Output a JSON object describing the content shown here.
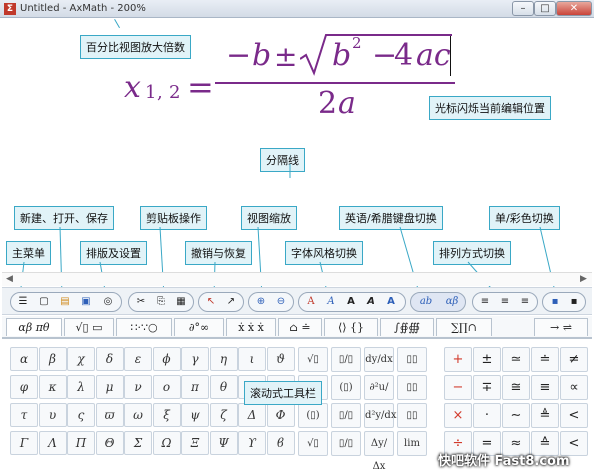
{
  "window": {
    "title": "Untitled - AxMath - 200%",
    "controls": [
      "–",
      "□",
      "✕"
    ]
  },
  "equation": {
    "x": "x",
    "sub1": "1",
    "comma": ",",
    "sub2": "2",
    "eq": "=",
    "minus": "−",
    "b": "b",
    "pm": "±",
    "b2": "b",
    "exp": "2",
    "minus2": "−",
    "four": "4",
    "ac": "ac",
    "denom_two": "2",
    "denom_a": "a"
  },
  "callouts": {
    "zoom": "百分比视图放大倍数",
    "cursor": "光标闪烁当前编辑位置",
    "divider": "分隔线",
    "new_open_save": "新建、打开、保存",
    "clipboard": "剪贴板操作",
    "view_zoom": "视图缩放",
    "keyboard": "英语/希腊键盘切换",
    "color": "单/彩色切换",
    "main_menu": "主菜单",
    "layout": "排版及设置",
    "undo": "撤销与恢复",
    "font_style": "字体风格切换",
    "align": "排列方式切换",
    "scroll_toolbar": "滚动式工具栏"
  },
  "toolbar": {
    "menu": "☰",
    "new": "▢",
    "open": "▤",
    "save": "▣",
    "settings": "◎",
    "cut": "✂",
    "copy": "⎘",
    "paste": "▦",
    "undo": "↖",
    "redo": "↗",
    "zoom_in": "⊕",
    "zoom_out": "⊖",
    "font_a1": "A",
    "font_a2": "A",
    "font_a3": "A",
    "font_a4": "A",
    "font_a5": "A",
    "kb_en": "ab",
    "kb_gr": "αβ",
    "align_l": "≡",
    "align_c": "≡",
    "align_r": "≡",
    "mono": "▪",
    "multi": "▪"
  },
  "tabs": [
    "αβ πθ",
    "√▯ ▭",
    "∷·∵○",
    "∂°∞",
    "ẋ ẋ ẋ",
    "⌂ ≐",
    "⟨⟩ {}",
    "∫∯∰",
    "∑∏∩",
    "→ ⇌"
  ],
  "greek": [
    [
      "α",
      "β",
      "χ",
      "δ",
      "ε",
      "ϕ",
      "γ",
      "η",
      "ι",
      "ϑ"
    ],
    [
      "φ",
      "κ",
      "λ",
      "μ",
      "ν",
      "ο",
      "π",
      "θ",
      "ρ",
      "σ"
    ],
    [
      "τ",
      "υ",
      "ς",
      "ϖ",
      "ω",
      "ξ",
      "ψ",
      "ζ",
      "Δ",
      "Φ"
    ],
    [
      "Γ",
      "Λ",
      "Π",
      "Θ",
      "Σ",
      "Ω",
      "Ξ",
      "Ψ",
      "ϒ",
      "ϐ"
    ]
  ],
  "templates": [
    [
      "√▯",
      "▯/▯",
      "dy/dx",
      "▯▯"
    ],
    [
      "▯√",
      "(▯)",
      "∂²u/∂x∂y",
      "▯▯"
    ],
    [
      "(▯)",
      "▯/▯",
      "d²y/dx²",
      "▯▯"
    ],
    [
      "√▯",
      "▯/▯",
      "Δy/Δx",
      "lim"
    ]
  ],
  "operators": [
    [
      "+",
      "±",
      "≃",
      "≐",
      "≠"
    ],
    [
      "−",
      "∓",
      "≅",
      "≡",
      "∝"
    ],
    [
      "×",
      "·",
      "∼",
      "≜",
      "<"
    ],
    [
      "÷",
      "=",
      "≈",
      "≙",
      "<"
    ]
  ],
  "colors": {
    "op_red": "#d23b2c",
    "eq_purple": "#7a2a8a",
    "eq_blue": "#2d5fb8"
  },
  "watermark": "快吧软件 Fast8.com"
}
